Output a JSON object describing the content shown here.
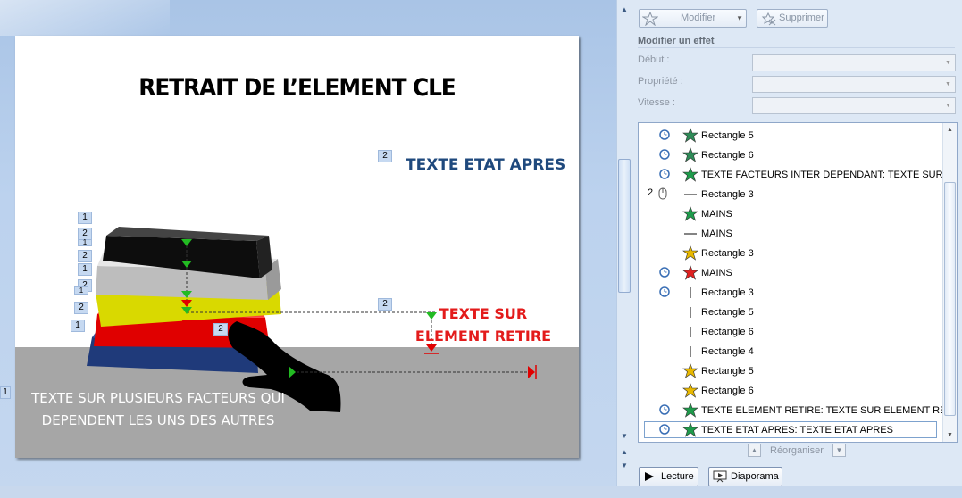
{
  "slide": {
    "title": "RETRAIT DE L’ELEMENT CLE",
    "text_apres": "TEXTE ETAT APRES",
    "text_retire": "TEXTE SUR ELEMENT RETIRE",
    "text_plusieurs": "TEXTE SUR PLUSIEURS FACTEURS QUI DEPENDENT LES UNS DES AUTRES",
    "tags": [
      "1",
      "2",
      "1",
      "2",
      "1",
      "2",
      "1",
      "2",
      "1",
      "2",
      "2",
      "1"
    ],
    "edge_marker": "1"
  },
  "pane": {
    "modify_button": "Modifier",
    "delete_button": "Supprimer",
    "section_title": "Modifier un effet",
    "start_label": "Début :",
    "property_label": "Propriété :",
    "speed_label": "Vitesse :",
    "items": [
      {
        "num": "",
        "trigger": "clock",
        "effect": "motion-star",
        "label": "Rectangle 5"
      },
      {
        "num": "",
        "trigger": "clock",
        "effect": "motion-star",
        "label": "Rectangle 6"
      },
      {
        "num": "",
        "trigger": "clock",
        "effect": "entrance-star",
        "label": "TEXTE FACTEURS INTER DEPENDANT: TEXTE SUR P..."
      },
      {
        "num": "2",
        "trigger": "mouse",
        "effect": "line",
        "label": "Rectangle 3"
      },
      {
        "num": "",
        "trigger": "",
        "effect": "entrance-star",
        "label": "MAINS"
      },
      {
        "num": "",
        "trigger": "",
        "effect": "line",
        "label": "MAINS"
      },
      {
        "num": "",
        "trigger": "",
        "effect": "emphasis-star",
        "label": "Rectangle 3"
      },
      {
        "num": "",
        "trigger": "clock",
        "effect": "exit-star",
        "label": "MAINS"
      },
      {
        "num": "",
        "trigger": "clock",
        "effect": "vline",
        "label": "Rectangle 3"
      },
      {
        "num": "",
        "trigger": "",
        "effect": "vline",
        "label": "Rectangle 5"
      },
      {
        "num": "",
        "trigger": "",
        "effect": "vline",
        "label": "Rectangle 6"
      },
      {
        "num": "",
        "trigger": "",
        "effect": "vline",
        "label": "Rectangle 4"
      },
      {
        "num": "",
        "trigger": "",
        "effect": "emphasis-star",
        "label": "Rectangle 5"
      },
      {
        "num": "",
        "trigger": "",
        "effect": "emphasis-star",
        "label": "Rectangle 6"
      },
      {
        "num": "",
        "trigger": "clock",
        "effect": "entrance-star",
        "label": "TEXTE ELEMENT RETIRE: TEXTE SUR ELEMENT RETI..."
      },
      {
        "num": "",
        "trigger": "clock",
        "effect": "entrance-star",
        "label": "TEXTE ETAT APRES: TEXTE ETAT APRES"
      }
    ],
    "reorder_label": "Réorganiser",
    "play_button": "Lecture",
    "slideshow_button": "Diaporama"
  },
  "colors": {
    "title_blue": "#1f497d",
    "text_red": "#e31b1b",
    "block_black": "#111111",
    "block_gray": "#c8c8c8",
    "block_yellow": "#e5e600",
    "block_red": "#e00000",
    "block_blue": "#1f3a7a"
  }
}
